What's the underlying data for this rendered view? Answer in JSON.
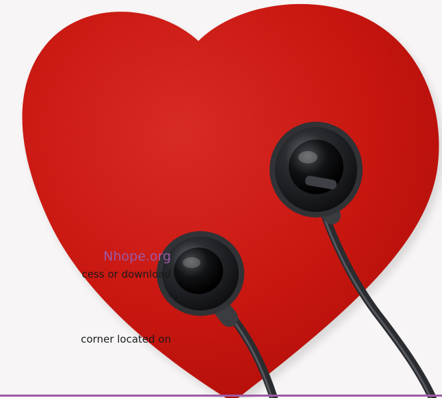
{
  "site_text": "Nhope.org",
  "body_lines": [
    "cess or download",
    "corner located on"
  ],
  "colors": {
    "accent": "#9b5aa5",
    "heart": "#e11a12",
    "background": "#f7f5f5",
    "earphone": "#2a2c30"
  },
  "objects": [
    "red-felt-heart",
    "black-earphones"
  ]
}
